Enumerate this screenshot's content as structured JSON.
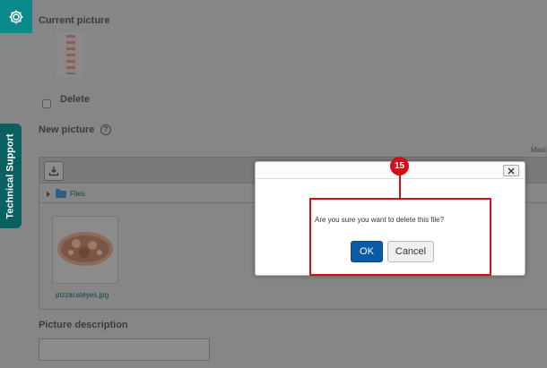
{
  "sidebar": {
    "settings_icon": "gear-icon",
    "tech_support_label": "Technical Support"
  },
  "form": {
    "current_picture_label": "Current picture",
    "delete_label": "Delete",
    "new_picture_label": "New picture",
    "help_icon": "question-circle-icon",
    "max_label": "Maxi",
    "picture_description_label": "Picture description",
    "picture_description_value": ""
  },
  "filepicker": {
    "download_icon": "download-icon",
    "path_label": "Files",
    "files": [
      {
        "name": "pizzacateyes.jpg"
      }
    ]
  },
  "dialog": {
    "message": "Are you sure you want to delete this file?",
    "ok_label": "OK",
    "cancel_label": "Cancel",
    "close_icon": "close-icon"
  },
  "annotation": {
    "step_number": "15",
    "highlight_color": "#d0101a"
  },
  "colors": {
    "accent": "#0a8a8a",
    "primary_button": "#0a5aa8",
    "overlay_background": "#868686"
  }
}
